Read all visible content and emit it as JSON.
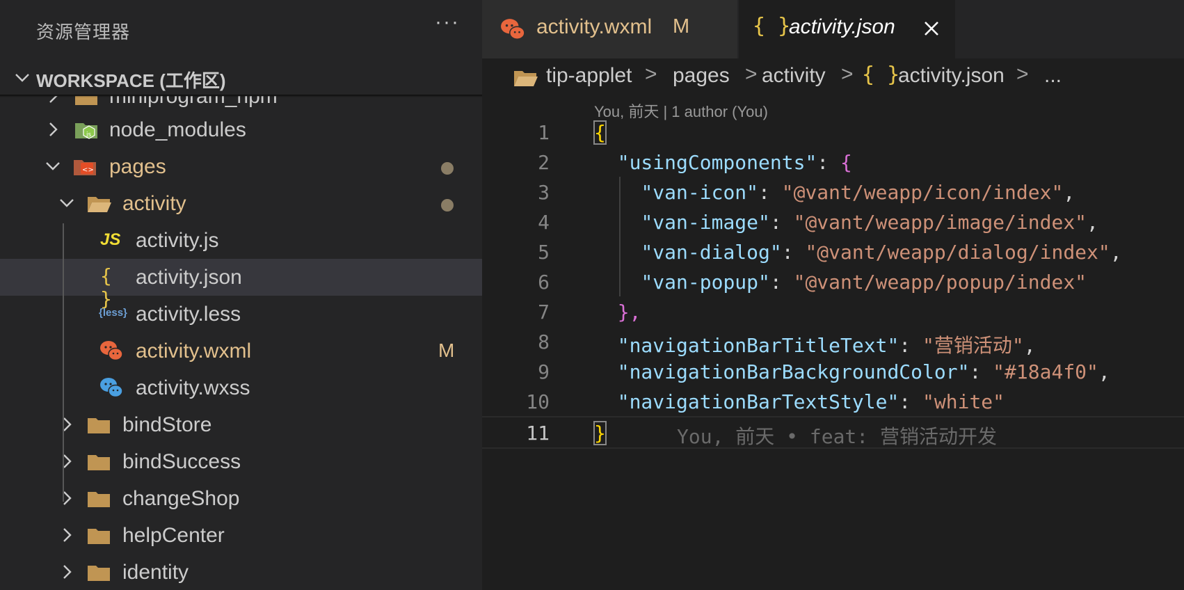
{
  "sidebar": {
    "title": "资源管理器",
    "more_label": "···",
    "workspace_title": "WORKSPACE (工作区)",
    "items": [
      {
        "label": "miniprogram_npm",
        "icon": "folder-icon"
      },
      {
        "label": "node_modules",
        "icon": "node-folder-icon"
      },
      {
        "label": "pages",
        "icon": "pages-folder-icon",
        "status": "dot"
      },
      {
        "label": "activity",
        "icon": "folder-open-icon",
        "status": "dot"
      },
      {
        "label": "activity.js",
        "icon": "js-file-icon",
        "glyph": "JS"
      },
      {
        "label": "activity.json",
        "icon": "json-file-icon",
        "glyph": "{ }",
        "selected": true
      },
      {
        "label": "activity.less",
        "icon": "less-file-icon",
        "glyph": "{less}"
      },
      {
        "label": "activity.wxml",
        "icon": "wechat-orange-icon",
        "status": "M"
      },
      {
        "label": "activity.wxss",
        "icon": "wechat-blue-icon"
      },
      {
        "label": "bindStore",
        "icon": "folder-icon"
      },
      {
        "label": "bindSuccess",
        "icon": "folder-icon"
      },
      {
        "label": "changeShop",
        "icon": "folder-icon"
      },
      {
        "label": "helpCenter",
        "icon": "folder-icon"
      },
      {
        "label": "identity",
        "icon": "folder-icon"
      }
    ]
  },
  "tabs": [
    {
      "label": "activity.wxml",
      "status": "M",
      "icon": "wechat-orange-icon"
    },
    {
      "label": "activity.json",
      "braces": "{ }",
      "icon": "json-braces-icon",
      "active": true
    }
  ],
  "breadcrumb": {
    "root": "tip-applet",
    "folder1": "pages",
    "folder2": "activity",
    "braces": "{ }",
    "file": "activity.json",
    "ellipsis": "...",
    "sep": ">"
  },
  "blame": {
    "header": "You, 前天 | 1 author (You)",
    "inline": "You, 前天 • feat: 营销活动开发"
  },
  "code": {
    "line_numbers": [
      "1",
      "2",
      "3",
      "4",
      "5",
      "6",
      "7",
      "8",
      "9",
      "10",
      "11"
    ],
    "keys": {
      "usingComponents": "\"usingComponents\"",
      "van_icon": "\"van-icon\"",
      "van_image": "\"van-image\"",
      "van_dialog": "\"van-dialog\"",
      "van_popup": "\"van-popup\"",
      "nav_title": "\"navigationBarTitleText\"",
      "nav_bg": "\"navigationBarBackgroundColor\"",
      "nav_style": "\"navigationBarTextStyle\""
    },
    "values": {
      "van_icon": "\"@vant/weapp/icon/index\"",
      "van_image": "\"@vant/weapp/image/index\"",
      "van_dialog": "\"@vant/weapp/dialog/index\"",
      "van_popup": "\"@vant/weapp/popup/index\"",
      "nav_title": "\"营销活动\"",
      "nav_bg": "\"#18a4f0\"",
      "nav_style": "\"white\""
    },
    "punct": {
      "open": "{",
      "close": "}",
      "colon": ": ",
      "comma": ",",
      "inner_open": "{",
      "inner_close": "},"
    }
  },
  "colors": {
    "background": "#1e1e1e",
    "sidebar": "#252526",
    "modified": "#e2c08d",
    "json_key": "#9cdcfe",
    "json_string": "#ce9178",
    "bracket_gold": "#ffd700",
    "bracket_purple": "#da70d6"
  }
}
